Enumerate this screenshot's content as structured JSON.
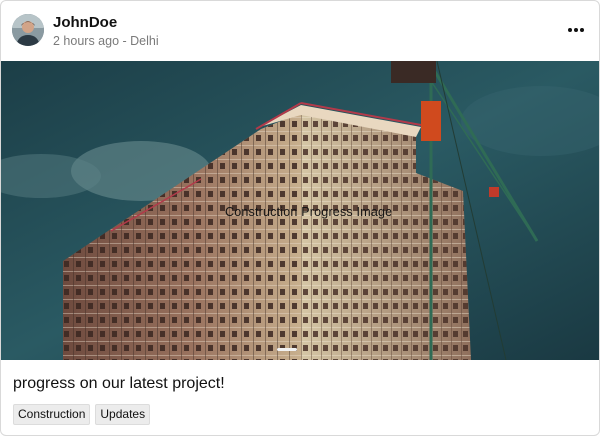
{
  "post": {
    "author": {
      "username": "JohnDoe",
      "meta": "2 hours ago - Delhi",
      "avatar_icon": "user-avatar"
    },
    "menu_icon": "more-horizontal-icon",
    "media": {
      "overlay_text": "Construction Progress Image",
      "carousel_index": 1,
      "colors": {
        "sky": "#1f4650",
        "scaffold": "#a07c6a",
        "crane": "#2f6b55",
        "crane_cab": "#d04a1e"
      }
    },
    "caption": "progress on our latest project!",
    "tags": [
      "Construction",
      "Updates"
    ]
  }
}
